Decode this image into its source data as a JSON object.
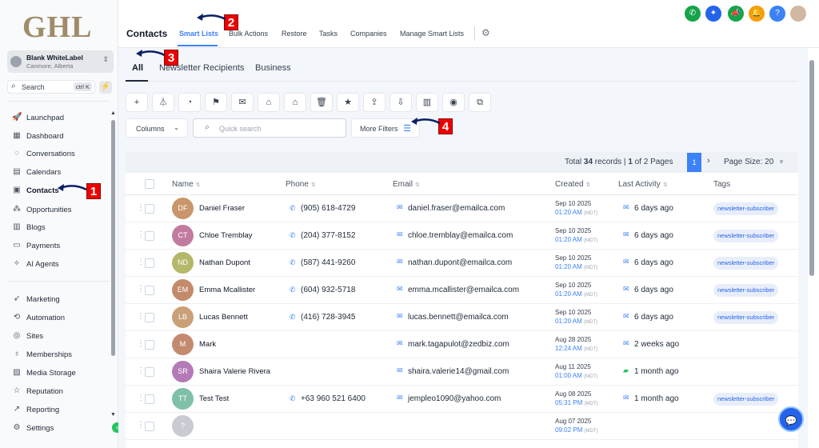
{
  "brand": {
    "logo_text": "GHL"
  },
  "location": {
    "name": "Blank WhiteLabel",
    "sub": "Canmore, Alberta"
  },
  "sidebar": {
    "search_label": "Search",
    "search_shortcut": "ctrl K",
    "items": [
      {
        "label": "Launchpad",
        "icon": "rocket-icon"
      },
      {
        "label": "Dashboard",
        "icon": "dashboard-icon"
      },
      {
        "label": "Conversations",
        "icon": "chat-icon"
      },
      {
        "label": "Calendars",
        "icon": "calendar-icon"
      },
      {
        "label": "Contacts",
        "icon": "contacts-icon"
      },
      {
        "label": "Opportunities",
        "icon": "opportunities-icon"
      },
      {
        "label": "Blogs",
        "icon": "blog-icon"
      },
      {
        "label": "Payments",
        "icon": "payments-icon"
      },
      {
        "label": "AI Agents",
        "icon": "ai-icon"
      },
      {
        "label": "Marketing",
        "icon": "megaphone-icon"
      },
      {
        "label": "Automation",
        "icon": "automation-icon"
      },
      {
        "label": "Sites",
        "icon": "globe-icon"
      },
      {
        "label": "Memberships",
        "icon": "membership-icon"
      },
      {
        "label": "Media Storage",
        "icon": "image-icon"
      },
      {
        "label": "Reputation",
        "icon": "star-icon"
      },
      {
        "label": "Reporting",
        "icon": "chart-icon"
      },
      {
        "label": "Settings",
        "icon": "gear-icon"
      }
    ]
  },
  "header": {
    "title": "Contacts",
    "tabs": [
      "Smart Lists",
      "Bulk Actions",
      "Restore",
      "Tasks",
      "Companies",
      "Manage Smart Lists"
    ],
    "active_tab": "Smart Lists"
  },
  "subtabs": [
    "All",
    "Newsletter Recipients",
    "Business"
  ],
  "toolbar": {
    "icons": [
      "add-icon",
      "filter-icon",
      "workflow-icon",
      "sms-icon",
      "email-icon",
      "add-tag-icon",
      "remove-tag-icon",
      "delete-icon",
      "star-icon",
      "export-icon",
      "import-icon",
      "company-icon",
      "whatsapp-icon",
      "merge-icon"
    ]
  },
  "filters": {
    "columns_label": "Columns",
    "search_placeholder": "Quick search",
    "more_filters_label": "More Filters"
  },
  "pagination": {
    "prefix": "Total ",
    "total": "34",
    "mid": " records | ",
    "current": "1",
    "suffix": " of 2 Pages",
    "page_button": "1",
    "page_size": "Page Size: 20"
  },
  "table": {
    "headers": [
      "Name",
      "Phone",
      "Email",
      "Created",
      "Last Activity",
      "Tags"
    ],
    "rows": [
      {
        "initials": "DF",
        "avatar_color": "#c9966b",
        "name": "Daniel Fraser",
        "phone": "(905) 618-4729",
        "email": "daniel.fraser@emailca.com",
        "created_date": "Sep 10 2025",
        "created_time": "01:20 AM",
        "tz": "(MDT)",
        "activity": "6 days ago",
        "activity_icon": "email",
        "tag": "newsletter-subscriber"
      },
      {
        "initials": "CT",
        "avatar_color": "#c27ba0",
        "name": "Chloe Tremblay",
        "phone": "(204) 377-8152",
        "email": "chloe.tremblay@emailca.com",
        "created_date": "Sep 10 2025",
        "created_time": "01:20 AM",
        "tz": "(MDT)",
        "activity": "6 days ago",
        "activity_icon": "email",
        "tag": "newsletter-subscriber"
      },
      {
        "initials": "ND",
        "avatar_color": "#b5b86a",
        "name": "Nathan Dupont",
        "phone": "(587) 441-9260",
        "email": "nathan.dupont@emailca.com",
        "created_date": "Sep 10 2025",
        "created_time": "01:20 AM",
        "tz": "(MDT)",
        "activity": "6 days ago",
        "activity_icon": "email",
        "tag": "newsletter-subscriber"
      },
      {
        "initials": "EM",
        "avatar_color": "#c48a6a",
        "name": "Emma Mcallister",
        "phone": "(604) 932-5718",
        "email": "emma.mcallister@emailca.com",
        "created_date": "Sep 10 2025",
        "created_time": "01:20 AM",
        "tz": "(MDT)",
        "activity": "6 days ago",
        "activity_icon": "email",
        "tag": "newsletter-subscriber"
      },
      {
        "initials": "LB",
        "avatar_color": "#c9a078",
        "name": "Lucas Bennett",
        "phone": "(416) 728-3945",
        "email": "lucas.bennett@emailca.com",
        "created_date": "Sep 10 2025",
        "created_time": "01:20 AM",
        "tz": "(MDT)",
        "activity": "6 days ago",
        "activity_icon": "email",
        "tag": "newsletter-subscriber"
      },
      {
        "initials": "M",
        "avatar_color": "#c48a70",
        "name": "Mark",
        "phone": "",
        "email": "mark.tagapulot@zedbiz.com",
        "created_date": "Aug 28 2025",
        "created_time": "12:24 AM",
        "tz": "(MDT)",
        "activity": "2 weeks ago",
        "activity_icon": "email",
        "tag": ""
      },
      {
        "initials": "SR",
        "avatar_color": "#b47ab8",
        "name": "Shaira Valerie Rivera",
        "phone": "",
        "email": "shaira.valerie14@gmail.com",
        "created_date": "Aug 11 2025",
        "created_time": "01:00 AM",
        "tz": "(MDT)",
        "activity": "1 month ago",
        "activity_icon": "chat",
        "tag": ""
      },
      {
        "initials": "TT",
        "avatar_color": "#7fc0a8",
        "name": "Test Test",
        "phone": "+63 960 521 6400",
        "email": "jempleo1090@yahoo.com",
        "created_date": "Aug 08 2025",
        "created_time": "05:31 PM",
        "tz": "(MDT)",
        "activity": "1 month ago",
        "activity_icon": "email",
        "tag": "newsletter-subscriber"
      },
      {
        "initials": "?",
        "avatar_color": "#c8ccd2",
        "name": "",
        "phone": "",
        "email": "",
        "created_date": "Aug 07 2025",
        "created_time": "09:02 PM",
        "tz": "(MDT)",
        "activity": "",
        "activity_icon": "",
        "tag": ""
      }
    ]
  },
  "annotations": [
    "1",
    "2",
    "3",
    "4"
  ]
}
